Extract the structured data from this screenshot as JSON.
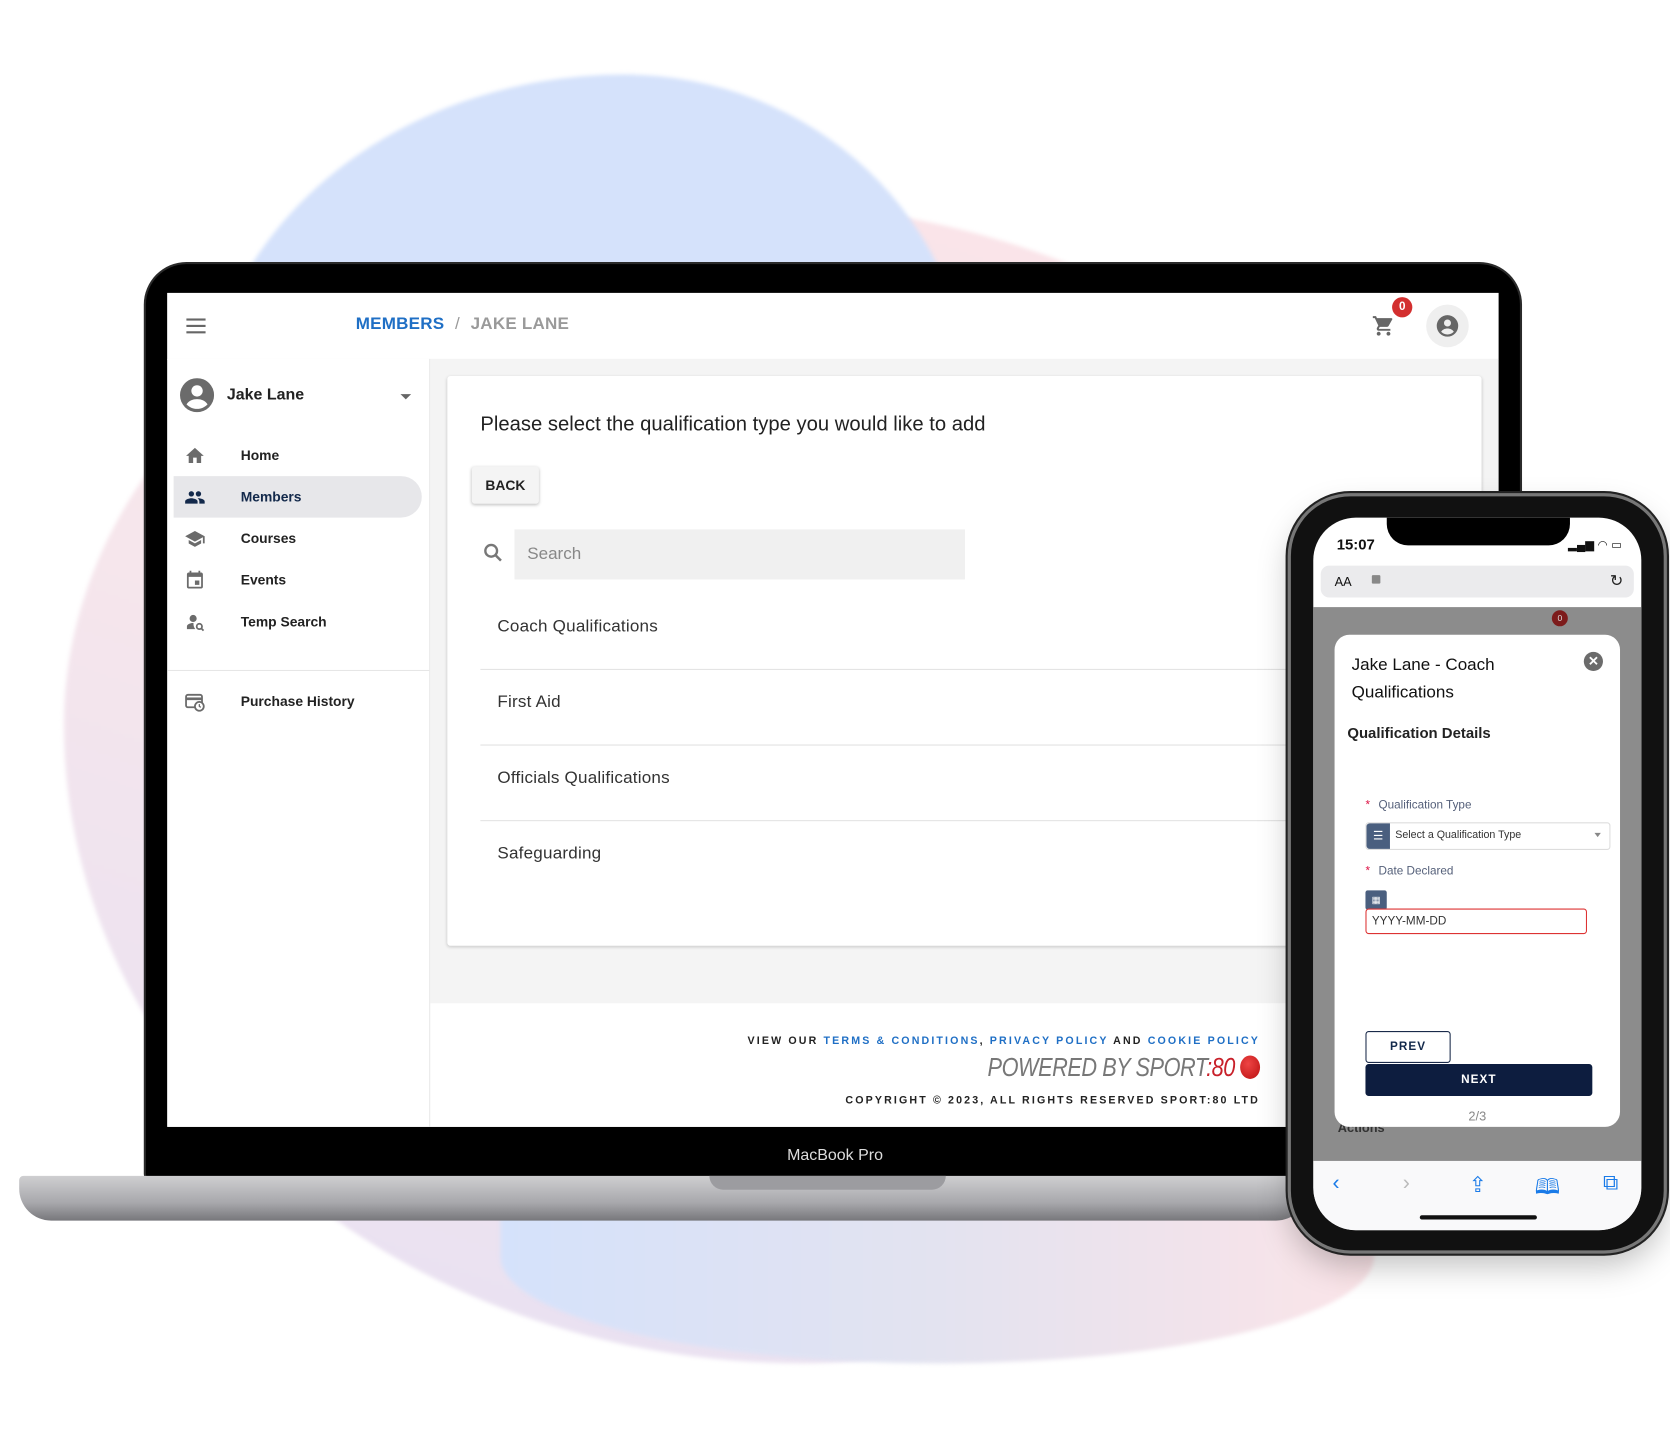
{
  "laptop": {
    "brand_label": "MacBook Pro",
    "header": {
      "breadcrumb": [
        {
          "label": "MEMBERS"
        },
        {
          "label": "JAKE LANE"
        }
      ],
      "breadcrumb_separator": "/",
      "cart_count": "0"
    },
    "sidebar": {
      "user_name": "Jake Lane",
      "items": [
        {
          "label": "Home",
          "icon": "home-icon",
          "active": false
        },
        {
          "label": "Members",
          "icon": "people-icon",
          "active": true
        },
        {
          "label": "Courses",
          "icon": "graduation-cap-icon",
          "active": false
        },
        {
          "label": "Events",
          "icon": "calendar-icon",
          "active": false
        },
        {
          "label": "Temp Search",
          "icon": "person-search-icon",
          "active": false
        }
      ],
      "secondary_items": [
        {
          "label": "Purchase History",
          "icon": "purchase-history-icon"
        }
      ]
    },
    "main": {
      "title": "Please select the qualification type you would like to add",
      "back_label": "BACK",
      "search_placeholder": "Search",
      "qualification_types": [
        "Coach Qualifications",
        "First Aid",
        "Officials Qualifications",
        "Safeguarding"
      ]
    },
    "footer": {
      "view_our": "VIEW OUR",
      "terms": "TERMS & CONDITIONS",
      "comma": ",",
      "privacy": "PRIVACY POLICY",
      "and": "AND",
      "cookie": "COOKIE POLICY",
      "powered_by": "POWERED BY SPORT",
      "powered_brand": ":80",
      "copyright": "COPYRIGHT © 2023, ALL RIGHTS RESERVED SPORT:80 LTD"
    }
  },
  "phone": {
    "status_time": "15:07",
    "url_aa": "AA",
    "cart_count": "0",
    "background_label": "Actions",
    "modal": {
      "title": "Jake Lane - Coach Qualifications",
      "subtitle": "Qualification Details",
      "qualification_type_label": "Qualification Type",
      "qualification_type_placeholder": "Select a Qualification Type",
      "date_declared_label": "Date Declared",
      "date_placeholder": "YYYY-MM-DD",
      "prev_label": "PREV",
      "next_label": "NEXT",
      "step": "2/3"
    }
  },
  "colors": {
    "accent": "#1f6fc5",
    "navy": "#0d1d3f",
    "badge": "#d32f2f",
    "required": "#d14"
  }
}
